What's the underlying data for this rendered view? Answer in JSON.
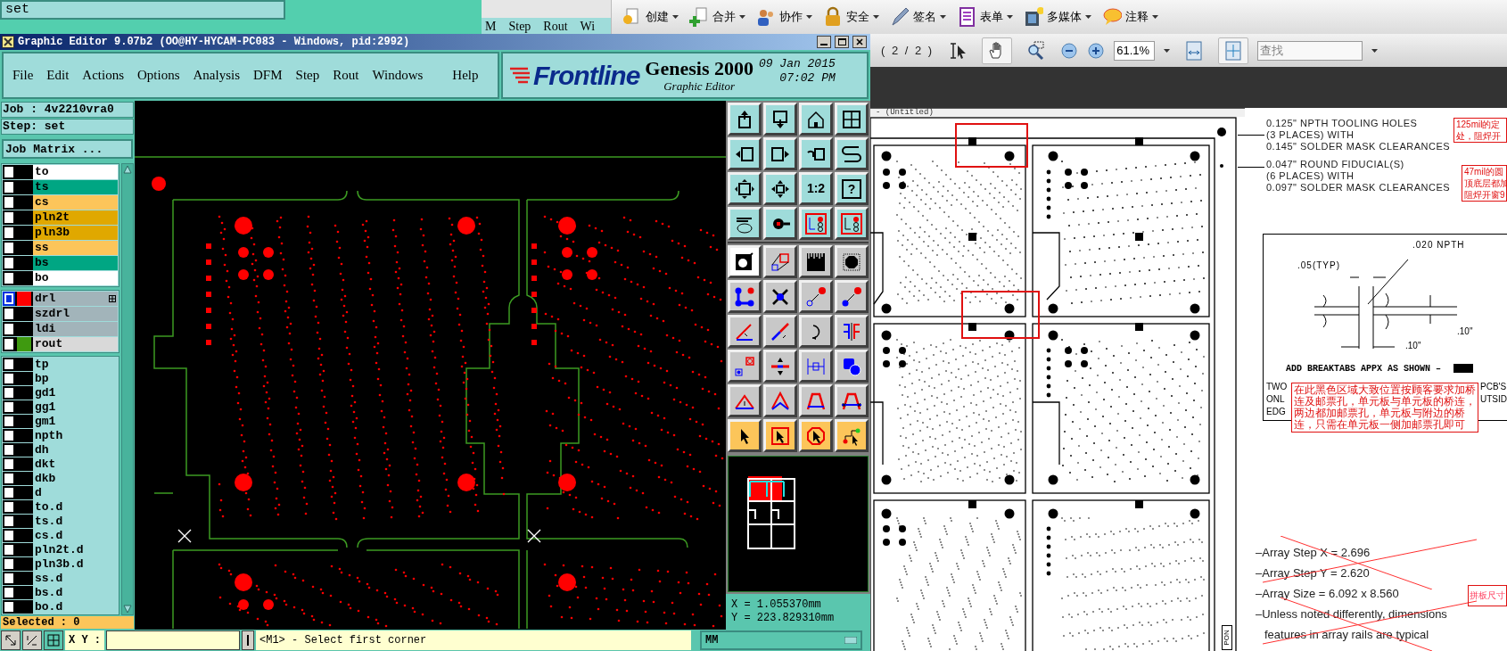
{
  "background_window": {
    "field_value": "set",
    "menu": [
      "M",
      "Step",
      "Rout",
      "Wi"
    ]
  },
  "acrobat": {
    "tasks": [
      {
        "label": "创建"
      },
      {
        "label": "合并"
      },
      {
        "label": "协作"
      },
      {
        "label": "安全"
      },
      {
        "label": "签名"
      },
      {
        "label": "表单"
      },
      {
        "label": "多媒体"
      },
      {
        "label": "注释"
      }
    ],
    "page_indicator": "( 2 / 2 )",
    "tools": [
      {
        "selected": false
      },
      {
        "selected": true
      },
      {
        "selected": false
      }
    ],
    "zoom": "61.1%",
    "fit": [
      {
        "selected": false
      },
      {
        "selected": true
      }
    ],
    "search": {
      "placeholder": "查找"
    },
    "doc_title": "- (Untitled)"
  },
  "genesis": {
    "title": "Graphic Editor 9.07b2 (OO@HY-HYCAM-PC083 - Windows, pid:2992)",
    "menu": [
      "File",
      "Edit",
      "Actions",
      "Options",
      "Analysis",
      "DFM",
      "Step",
      "Rout",
      "Windows",
      "Help"
    ],
    "brand": "Frontline",
    "product": "Genesis 2000",
    "subtitle": "Graphic Editor",
    "date": "09 Jan 2015",
    "time": "07:02 PM",
    "job": "Job : 4v2210vra0",
    "step": "Step: set",
    "job_matrix": "Job Matrix ...",
    "layer_groups": [
      {
        "layers": [
          {
            "name": "to",
            "color": "#ffffff",
            "selected": false,
            "attributes": false
          },
          {
            "name": "ts",
            "color": "#00a683",
            "selected": false,
            "attributes": false
          },
          {
            "name": "cs",
            "color": "#fcc55a",
            "selected": false,
            "attributes": false
          },
          {
            "name": "pln2t",
            "color": "#e0a800",
            "selected": false,
            "attributes": false
          },
          {
            "name": "pln3b",
            "color": "#e0a800",
            "selected": false,
            "attributes": false
          },
          {
            "name": "ss",
            "color": "#fcc55a",
            "selected": false,
            "attributes": false
          },
          {
            "name": "bs",
            "color": "#00a683",
            "selected": false,
            "attributes": false
          },
          {
            "name": "bo",
            "color": "#ffffff",
            "selected": false,
            "attributes": false
          }
        ]
      },
      {
        "layers": [
          {
            "name": "drl",
            "color": "#a2b4ba",
            "display": {
              "color": "#ff0000"
            },
            "selected": true,
            "attributes": true
          },
          {
            "name": "szdrl",
            "color": "#a2b4ba",
            "selected": false,
            "attributes": false
          },
          {
            "name": "ldi",
            "color": "#a2b4ba",
            "selected": false,
            "attributes": false
          },
          {
            "name": "rout",
            "color": "#d9d9d9",
            "display": {
              "color": "#3f9a10"
            },
            "selected": false,
            "attributes": false
          }
        ]
      },
      {
        "layers": [
          {
            "name": "tp",
            "color": "#9fdcda",
            "selected": false,
            "attributes": false
          },
          {
            "name": "bp",
            "color": "#9fdcda",
            "selected": false,
            "attributes": false
          },
          {
            "name": "gd1",
            "color": "#9fdcda",
            "selected": false,
            "attributes": false
          },
          {
            "name": "gg1",
            "color": "#9fdcda",
            "selected": false,
            "attributes": false
          },
          {
            "name": "gm1",
            "color": "#9fdcda",
            "selected": false,
            "attributes": false
          },
          {
            "name": "npth",
            "color": "#9fdcda",
            "selected": false,
            "attributes": false
          },
          {
            "name": "dh",
            "color": "#9fdcda",
            "selected": false,
            "attributes": false
          },
          {
            "name": "dkt",
            "color": "#9fdcda",
            "selected": false,
            "attributes": false
          },
          {
            "name": "dkb",
            "color": "#9fdcda",
            "selected": false,
            "attributes": false
          },
          {
            "name": "d",
            "color": "#9fdcda",
            "selected": false,
            "attributes": false
          },
          {
            "name": "to.d",
            "color": "#9fdcda",
            "selected": false,
            "attributes": false
          },
          {
            "name": "ts.d",
            "color": "#9fdcda",
            "selected": false,
            "attributes": false
          },
          {
            "name": "cs.d",
            "color": "#9fdcda",
            "selected": false,
            "attributes": false
          },
          {
            "name": "pln2t.d",
            "color": "#9fdcda",
            "selected": false,
            "attributes": false
          },
          {
            "name": "pln3b.d",
            "color": "#9fdcda",
            "selected": false,
            "attributes": false
          },
          {
            "name": "ss.d",
            "color": "#9fdcda",
            "selected": false,
            "attributes": false
          },
          {
            "name": "bs.d",
            "color": "#9fdcda",
            "selected": false,
            "attributes": false
          },
          {
            "name": "bo.d",
            "color": "#9fdcda",
            "selected": false,
            "attributes": false
          }
        ]
      }
    ],
    "selected_count": "Selected : 0",
    "palette_labels": [
      "1:2",
      "?"
    ],
    "coords": [
      "X = 1.055370mm",
      "Y = 223.829310mm"
    ],
    "xy_label": "X Y :",
    "prompt": "<M1> - Select first corner",
    "units": "MM"
  },
  "document": {
    "tooling_note": [
      "0.125\" NPTH TOOLING HOLES",
      "(3 PLACES) WITH",
      "0.145\" SOLDER MASK CLEARANCES"
    ],
    "fiducial_note": [
      "0.047\" ROUND FIDUCIAL(S)",
      "(6 PLACES) WITH",
      "0.097\" SOLDER MASK CLEARANCES"
    ],
    "annotations": [
      {
        "lines": [
          "125mil的定",
          "处，阻焊开"
        ]
      },
      {
        "lines": [
          "47mil的圆",
          "顶底层都加",
          "阻焊开窗9"
        ]
      }
    ],
    "detail": {
      "npth": ".020 NPTH",
      "typ": ".05(TYP)",
      "dim_right": ".10\"",
      "dim_bottom": ".10\"",
      "breaktabs": "ADD BREAKTABS APPX AS SHOWN –"
    },
    "hidden_fragments": [
      "TWO",
      "ONL",
      "EDG",
      "PCB'S",
      "UTSID"
    ],
    "red_note": "在此黑色区域大致位置按顾客要求加桥连及邮票孔，单元板与单元板的桥连，两边都加邮票孔，单元板与附边的桥连，只需在单元板一侧加邮票孔即可",
    "array_lines": [
      {
        "text": "–Array Step X = 2.696",
        "crossed": true
      },
      {
        "text": "–Array Step Y = 2.620",
        "crossed": true
      },
      {
        "text": "–Array Size = 6.092 x 8.560",
        "crossed": false
      },
      {
        "text": "–Unless noted differently, dimensions",
        "crossed": true
      },
      {
        "text": "features in array rails are typical",
        "crossed": true
      }
    ],
    "size_annotation": "拼板尺寸",
    "rail_label": "PON"
  }
}
